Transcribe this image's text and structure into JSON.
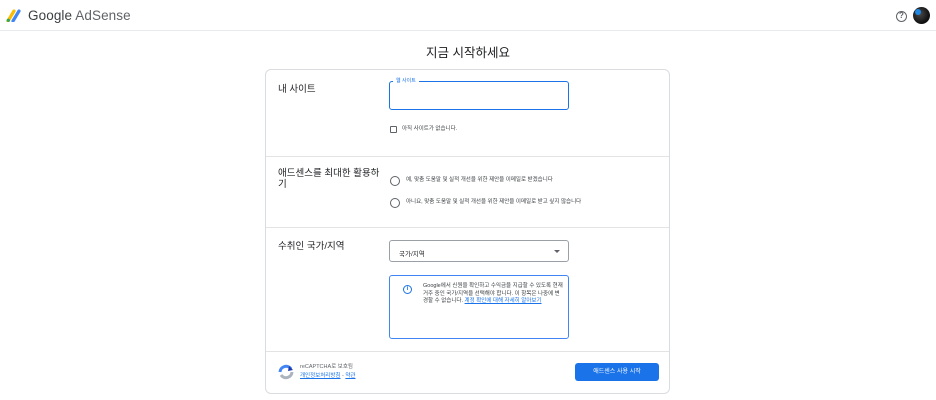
{
  "header": {
    "brand_google": "Google",
    "brand_product": "AdSense",
    "help_glyph": "?",
    "logo_icon": "adsense-logo-icon",
    "avatar_icon": "account-avatar"
  },
  "page": {
    "title": "지금 시작하세요"
  },
  "site_section": {
    "label": "내 사이트",
    "input_legend": "웹 사이트",
    "input_value": "",
    "checkbox_label": "아직 사이트가 없습니다.",
    "checkbox_checked": false
  },
  "email_section": {
    "label": "애드센스를 최대한 활용하기",
    "options": [
      {
        "label": "예, 맞춤 도움말 및 실적 개선을 위한 제안을 이메일로 받겠습니다",
        "selected": false
      },
      {
        "label": "아니요, 맞춤 도움말 및 실적 개선을 위한 제안을 이메일로 받고 싶지 않습니다",
        "selected": false
      }
    ]
  },
  "country_section": {
    "label": "수취인 국가/지역",
    "select_value": "국가/지역",
    "info_text": "Google에서 신원을 확인하고 수익금을 지급할 수 있도록 현재 거주 중인 국가/지역을 선택해야 합니다. 이 항목은 나중에 변경할 수 없습니다.",
    "info_link": "계정 확인에 대해 자세히 알아보기",
    "info_icon": "info-icon"
  },
  "footer": {
    "recaptcha_title": "reCAPTCHA로 보호됨",
    "privacy_link": "개인정보처리방침",
    "separator": " - ",
    "terms_link": "약관",
    "submit_label": "애드센스 사용 시작"
  },
  "colors": {
    "accent": "#1a73e8",
    "border": "#dadce0",
    "text": "#202124"
  }
}
